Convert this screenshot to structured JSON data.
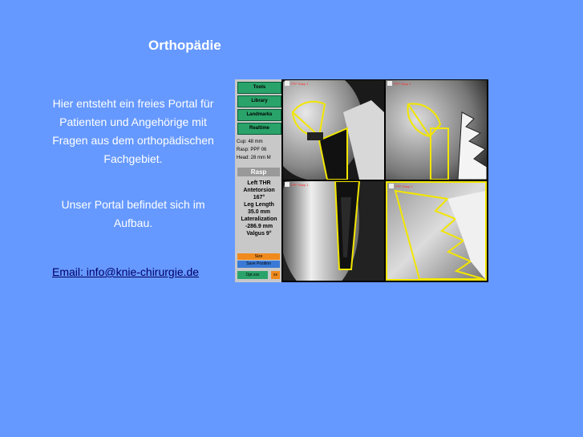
{
  "page": {
    "title": "Orthopädie",
    "intro_lines": [
      "Hier entsteht ein freies Portal für",
      "Patienten und Angehörige mit",
      "Fragen aus dem orthopädischen",
      "Fachgebiet."
    ],
    "portal_lines": [
      "Unser Portal befindet sich im",
      "Aufbau."
    ],
    "email_link": "Email: info@knie-chirurgie.de"
  },
  "software": {
    "buttons": [
      "Tools",
      "Library",
      "Landmarks",
      "Realtime"
    ],
    "info": [
      "Cup:    48 mm",
      "Rasp: PPF 06",
      "Head:  28 mm M"
    ],
    "rasp_label": "Rasp",
    "stats": [
      "Left THR",
      "Antetorsion",
      "167°",
      "Leg Length",
      "35.0 mm",
      "Lateralization",
      "-286.9 mm",
      "Valgus      9°"
    ],
    "size_label": "Size",
    "save_position": "Save Position",
    "opt_label": "Opt.xxx",
    "opt2_label": "xx",
    "view_labels": [
      "PPF Rasp 1",
      "PPF Rasp 1",
      "PPF Rasp 1",
      "PPF Rasp 1"
    ]
  },
  "colors": {
    "background": "#6699ff",
    "text": "#ffffff",
    "link": "#000066",
    "overlay": "#f2e600"
  }
}
